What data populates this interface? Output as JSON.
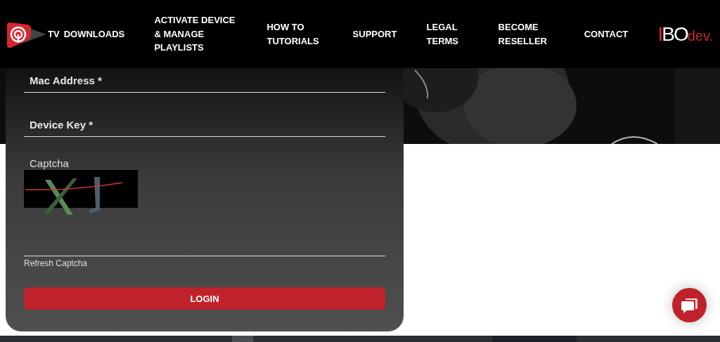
{
  "header": {
    "logo_text": "TV",
    "nav_items": [
      {
        "label": "DOWNLOADS"
      },
      {
        "label": "ACTIVATE DEVICE & MANAGE PLAYLISTS"
      },
      {
        "label": "HOW TO TUTORIALS"
      },
      {
        "label": "SUPPORT"
      },
      {
        "label": "LEGAL TERMS"
      },
      {
        "label": "BECOME RESELLER"
      },
      {
        "label": "CONTACT"
      }
    ],
    "brand": {
      "mark_red": "I",
      "mark": "BO",
      "suffix": "dev."
    }
  },
  "login_form": {
    "fields": [
      {
        "placeholder": "Mac Address *"
      },
      {
        "placeholder": "Device Key *"
      }
    ],
    "captcha": {
      "label": "Captcha",
      "link": "Refresh Captcha"
    },
    "submit": "LOGIN"
  }
}
